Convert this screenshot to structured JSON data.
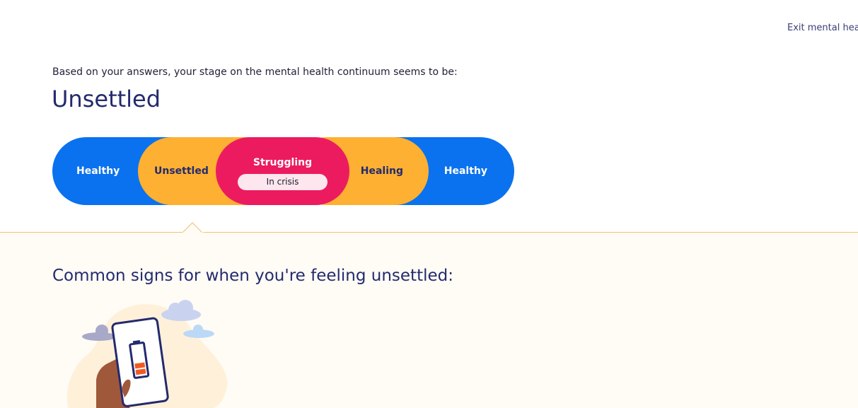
{
  "header": {
    "exit_link": "Exit mental hea"
  },
  "result": {
    "intro": "Based on your answers, your stage on the mental health continuum seems to be:",
    "stage": "Unsettled"
  },
  "continuum": {
    "segments": [
      {
        "label": "Healthy",
        "color": "#0a72ee"
      },
      {
        "label": "Unsettled",
        "color": "#fdb031"
      },
      {
        "label": "Struggling",
        "color": "#ec1b5f"
      },
      {
        "label": "Healing",
        "color": "#fdb031"
      },
      {
        "label": "Healthy",
        "color": "#0a72ee"
      }
    ],
    "crisis_label": "In crisis",
    "selected": "Unsettled"
  },
  "signs": {
    "heading": "Common signs for when you're feeling unsettled:"
  },
  "colors": {
    "title": "#232a6e",
    "divider": "#f3bf6a",
    "lower_bg": "#fffbf5"
  },
  "icons": {
    "illustration": "phone-low-battery-illustration"
  }
}
